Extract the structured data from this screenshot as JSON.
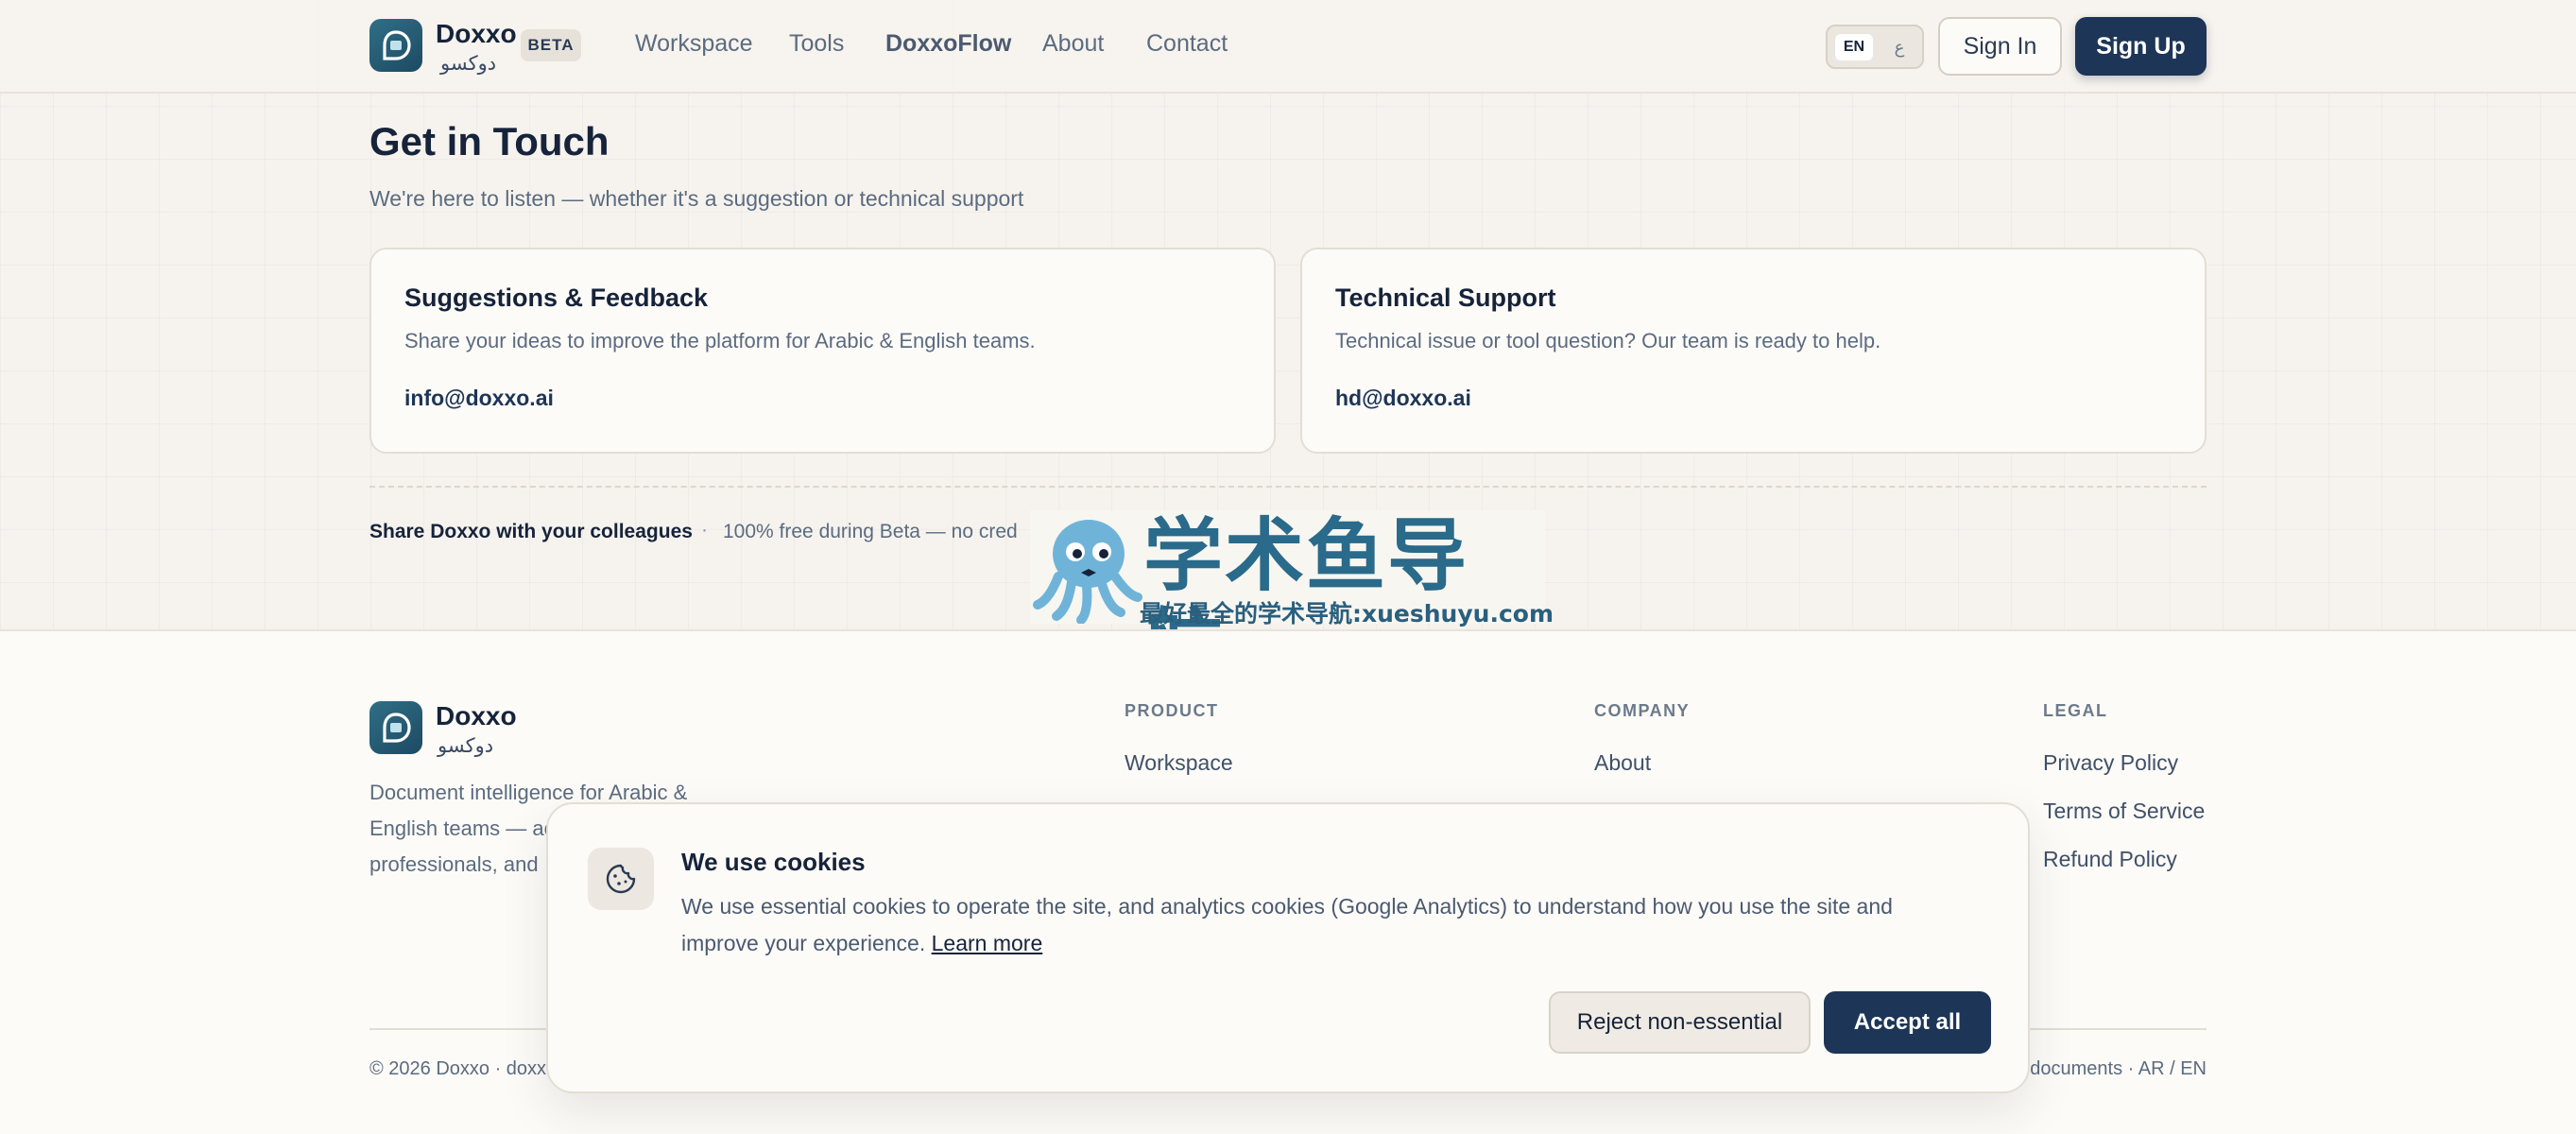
{
  "nav": {
    "brand_name": "Doxxo",
    "brand_arabic": "دوكسو",
    "beta_badge": "BETA",
    "links": [
      "Workspace",
      "Tools",
      "DoxxoFlow",
      "About",
      "Contact"
    ],
    "lang_en": "EN",
    "lang_ar": "ع",
    "sign_in": "Sign In",
    "sign_up": "Sign Up"
  },
  "hero": {
    "title": "Get in Touch",
    "subtitle": "We're here to listen — whether it's a suggestion or technical support"
  },
  "cards": [
    {
      "title": "Suggestions & Feedback",
      "description": "Share your ideas to improve the platform for Arabic & English teams.",
      "email": "info@doxxo.ai"
    },
    {
      "title": "Technical Support",
      "description": "Technical issue or tool question? Our team is ready to help.",
      "email": "hd@doxxo.ai"
    }
  ],
  "share": {
    "label": "Share Doxxo with your colleagues",
    "separator": "·",
    "free_text": "100% free during Beta — no cred"
  },
  "watermark": {
    "main": "学术鱼导航",
    "sub": "最好最全的学术导航:xueshuyu.com"
  },
  "footer": {
    "brand_name": "Doxxo",
    "brand_arabic": "دوكسو",
    "description_lines": [
      "Document intelligence for Arabic &",
      "English teams — ac",
      "professionals, and"
    ],
    "columns": [
      {
        "heading": "PRODUCT",
        "links": [
          "Workspace"
        ]
      },
      {
        "heading": "COMPANY",
        "links": [
          "About"
        ]
      },
      {
        "heading": "LEGAL",
        "links": [
          "Privacy Policy",
          "Terms of Service",
          "Refund Policy"
        ]
      }
    ],
    "copyright": "© 2026 Doxxo · doxxo",
    "right_text": "documents · AR / EN"
  },
  "cookie": {
    "title": "We use cookies",
    "text": "We use essential cookies to operate the site, and analytics cookies (Google Analytics) to understand how you use the site and improve your experience.",
    "learn_more": "Learn more",
    "reject": "Reject non-essential",
    "accept": "Accept all"
  }
}
